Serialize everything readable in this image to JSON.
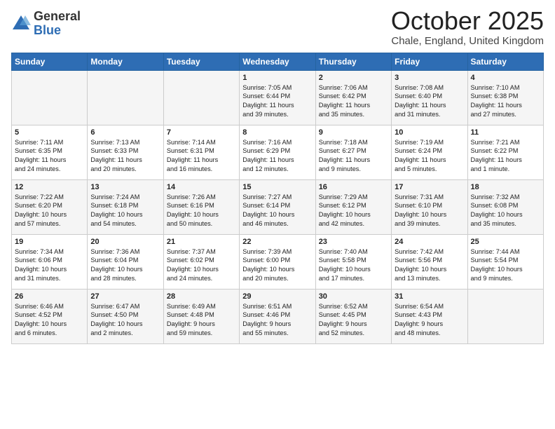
{
  "logo": {
    "general": "General",
    "blue": "Blue"
  },
  "title": "October 2025",
  "location": "Chale, England, United Kingdom",
  "days_of_week": [
    "Sunday",
    "Monday",
    "Tuesday",
    "Wednesday",
    "Thursday",
    "Friday",
    "Saturday"
  ],
  "weeks": [
    [
      {
        "day": "",
        "info": ""
      },
      {
        "day": "",
        "info": ""
      },
      {
        "day": "",
        "info": ""
      },
      {
        "day": "1",
        "info": "Sunrise: 7:05 AM\nSunset: 6:44 PM\nDaylight: 11 hours\nand 39 minutes."
      },
      {
        "day": "2",
        "info": "Sunrise: 7:06 AM\nSunset: 6:42 PM\nDaylight: 11 hours\nand 35 minutes."
      },
      {
        "day": "3",
        "info": "Sunrise: 7:08 AM\nSunset: 6:40 PM\nDaylight: 11 hours\nand 31 minutes."
      },
      {
        "day": "4",
        "info": "Sunrise: 7:10 AM\nSunset: 6:38 PM\nDaylight: 11 hours\nand 27 minutes."
      }
    ],
    [
      {
        "day": "5",
        "info": "Sunrise: 7:11 AM\nSunset: 6:35 PM\nDaylight: 11 hours\nand 24 minutes."
      },
      {
        "day": "6",
        "info": "Sunrise: 7:13 AM\nSunset: 6:33 PM\nDaylight: 11 hours\nand 20 minutes."
      },
      {
        "day": "7",
        "info": "Sunrise: 7:14 AM\nSunset: 6:31 PM\nDaylight: 11 hours\nand 16 minutes."
      },
      {
        "day": "8",
        "info": "Sunrise: 7:16 AM\nSunset: 6:29 PM\nDaylight: 11 hours\nand 12 minutes."
      },
      {
        "day": "9",
        "info": "Sunrise: 7:18 AM\nSunset: 6:27 PM\nDaylight: 11 hours\nand 9 minutes."
      },
      {
        "day": "10",
        "info": "Sunrise: 7:19 AM\nSunset: 6:24 PM\nDaylight: 11 hours\nand 5 minutes."
      },
      {
        "day": "11",
        "info": "Sunrise: 7:21 AM\nSunset: 6:22 PM\nDaylight: 11 hours\nand 1 minute."
      }
    ],
    [
      {
        "day": "12",
        "info": "Sunrise: 7:22 AM\nSunset: 6:20 PM\nDaylight: 10 hours\nand 57 minutes."
      },
      {
        "day": "13",
        "info": "Sunrise: 7:24 AM\nSunset: 6:18 PM\nDaylight: 10 hours\nand 54 minutes."
      },
      {
        "day": "14",
        "info": "Sunrise: 7:26 AM\nSunset: 6:16 PM\nDaylight: 10 hours\nand 50 minutes."
      },
      {
        "day": "15",
        "info": "Sunrise: 7:27 AM\nSunset: 6:14 PM\nDaylight: 10 hours\nand 46 minutes."
      },
      {
        "day": "16",
        "info": "Sunrise: 7:29 AM\nSunset: 6:12 PM\nDaylight: 10 hours\nand 42 minutes."
      },
      {
        "day": "17",
        "info": "Sunrise: 7:31 AM\nSunset: 6:10 PM\nDaylight: 10 hours\nand 39 minutes."
      },
      {
        "day": "18",
        "info": "Sunrise: 7:32 AM\nSunset: 6:08 PM\nDaylight: 10 hours\nand 35 minutes."
      }
    ],
    [
      {
        "day": "19",
        "info": "Sunrise: 7:34 AM\nSunset: 6:06 PM\nDaylight: 10 hours\nand 31 minutes."
      },
      {
        "day": "20",
        "info": "Sunrise: 7:36 AM\nSunset: 6:04 PM\nDaylight: 10 hours\nand 28 minutes."
      },
      {
        "day": "21",
        "info": "Sunrise: 7:37 AM\nSunset: 6:02 PM\nDaylight: 10 hours\nand 24 minutes."
      },
      {
        "day": "22",
        "info": "Sunrise: 7:39 AM\nSunset: 6:00 PM\nDaylight: 10 hours\nand 20 minutes."
      },
      {
        "day": "23",
        "info": "Sunrise: 7:40 AM\nSunset: 5:58 PM\nDaylight: 10 hours\nand 17 minutes."
      },
      {
        "day": "24",
        "info": "Sunrise: 7:42 AM\nSunset: 5:56 PM\nDaylight: 10 hours\nand 13 minutes."
      },
      {
        "day": "25",
        "info": "Sunrise: 7:44 AM\nSunset: 5:54 PM\nDaylight: 10 hours\nand 9 minutes."
      }
    ],
    [
      {
        "day": "26",
        "info": "Sunrise: 6:46 AM\nSunset: 4:52 PM\nDaylight: 10 hours\nand 6 minutes."
      },
      {
        "day": "27",
        "info": "Sunrise: 6:47 AM\nSunset: 4:50 PM\nDaylight: 10 hours\nand 2 minutes."
      },
      {
        "day": "28",
        "info": "Sunrise: 6:49 AM\nSunset: 4:48 PM\nDaylight: 9 hours\nand 59 minutes."
      },
      {
        "day": "29",
        "info": "Sunrise: 6:51 AM\nSunset: 4:46 PM\nDaylight: 9 hours\nand 55 minutes."
      },
      {
        "day": "30",
        "info": "Sunrise: 6:52 AM\nSunset: 4:45 PM\nDaylight: 9 hours\nand 52 minutes."
      },
      {
        "day": "31",
        "info": "Sunrise: 6:54 AM\nSunset: 4:43 PM\nDaylight: 9 hours\nand 48 minutes."
      },
      {
        "day": "",
        "info": ""
      }
    ]
  ]
}
